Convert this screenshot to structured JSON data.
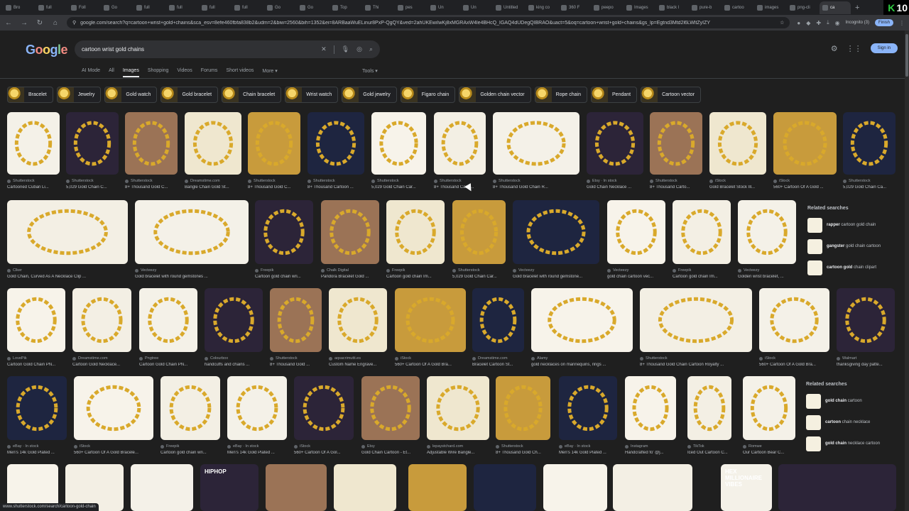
{
  "browser": {
    "tabs": [
      {
        "label": "Bro"
      },
      {
        "label": "full"
      },
      {
        "label": "Foll"
      },
      {
        "label": "Go"
      },
      {
        "label": "full"
      },
      {
        "label": "full"
      },
      {
        "label": "full"
      },
      {
        "label": "full"
      },
      {
        "label": "Go"
      },
      {
        "label": "Go"
      },
      {
        "label": "Top"
      },
      {
        "label": "Thi"
      },
      {
        "label": "pes"
      },
      {
        "label": "Un"
      },
      {
        "label": "Un"
      },
      {
        "label": "Untitled"
      },
      {
        "label": "king co"
      },
      {
        "label": "360 F"
      },
      {
        "label": "peepo"
      },
      {
        "label": "Images"
      },
      {
        "label": "black l"
      },
      {
        "label": "pure-b"
      },
      {
        "label": "cartoo"
      },
      {
        "label": "images"
      },
      {
        "label": "png-cli"
      },
      {
        "label": "ca"
      }
    ],
    "new_tab": "+",
    "profile_badge": "10",
    "profile_letter": "K",
    "url": "google.com/search?q=cartoon+wrist+gold+chains&sca_esv=8efe460fbfa838b2&udm=2&biw=2560&bih=1352&ei=8ARBaaWuELinur8PxP-QgQY&ved=2ahUKEwiIwKj8xMGRAxW4le4BHcQ_IGAQ4dUDegQIBRAO&uact=5&oq=cartoon+wrist+gold+chains&gs_lp=Egtnd3Mtd2l6LWltZyIZY",
    "incognito": "Incognito (3)",
    "finish": "Finish"
  },
  "google": {
    "logo": [
      "G",
      "o",
      "o",
      "g",
      "l",
      "e"
    ],
    "query": "cartoon wrist gold chains",
    "sign_in": "Sign in",
    "tabs": [
      "AI Mode",
      "All",
      "Images",
      "Shopping",
      "Videos",
      "Forums",
      "Short videos",
      "More ▾"
    ],
    "active_tab": "Images",
    "tools": "Tools ▾"
  },
  "chips": [
    "Bracelet",
    "Jewelry",
    "Gold watch",
    "Gold bracelet",
    "Chain bracelet",
    "Wrist watch",
    "Gold jewelry",
    "Figaro chain",
    "Golden chain vector",
    "Rope chain",
    "Pendant",
    "Cartoon vector"
  ],
  "rows": [
    [
      {
        "src": "Shutterstock",
        "title": "Cartooned Cuban Li..."
      },
      {
        "src": "Shutterstock",
        "title": "5,029 Gold Chain C..."
      },
      {
        "src": "Shutterstock",
        "title": "8+ Thousand Gold C..."
      },
      {
        "src": "Dreamstime.com",
        "title": "Bangle Chain Gold St..."
      },
      {
        "src": "Shutterstock",
        "title": "8+ Thousand Gold C..."
      },
      {
        "src": "Shutterstock",
        "title": "8+ Thousand Cartoon ..."
      },
      {
        "src": "Shutterstock",
        "title": "5,029 Gold Chain Car..."
      },
      {
        "src": "Shutterstock",
        "title": "8+ Thousand Carto..."
      },
      {
        "src": "Shutterstock",
        "title": "8+ Thousand Gold Chain R..."
      },
      {
        "src": "Etsy · In stock",
        "title": "Gold Chain Necklace ..."
      },
      {
        "src": "Shutterstock",
        "title": "8+ Thousand Carto..."
      },
      {
        "src": "iStock",
        "title": "Gold Bracelet Stock Ill..."
      },
      {
        "src": "iStock",
        "title": "560+ Cartoon Of A Gold ..."
      },
      {
        "src": "Shutterstock",
        "title": "5,029 Gold Chain Ca..."
      }
    ],
    [
      {
        "src": "Clker",
        "title": "Gold Chain, Curved As A Necklace Clip ..."
      },
      {
        "src": "Vecteezy",
        "title": "Gold bracelet with round gemstones ..."
      },
      {
        "src": "Freepik",
        "title": "Cartoon gold chain wri..."
      },
      {
        "src": "Chalk Digital",
        "title": "Pandora Bracelet Gold ..."
      },
      {
        "src": "Freepik",
        "title": "Cartoon gold chain Im..."
      },
      {
        "src": "Shutterstock",
        "title": "5,029 Gold Chain Car..."
      },
      {
        "src": "Vecteezy",
        "title": "Gold bracelet with round gemstone..."
      },
      {
        "src": "Vecteezy",
        "title": "gold chain cartoon vec..."
      },
      {
        "src": "Freepik",
        "title": "Cartoon gold chain Im..."
      },
      {
        "src": "Vecteezy",
        "title": "Golden wrist bracelet, ..."
      }
    ],
    [
      {
        "src": "LovePik",
        "title": "Cartoon Gold Chain PN..."
      },
      {
        "src": "Dreamstime.com",
        "title": "Cartoon Gold Necklace..."
      },
      {
        "src": "Pngtree",
        "title": "Cartoon Gold Chain PN..."
      },
      {
        "src": "Colourbox",
        "title": "handcuffs and chains ..."
      },
      {
        "src": "Shutterstock",
        "title": "8+ Thousand Gold ..."
      },
      {
        "src": "aqsacrimutti.es",
        "title": "Custom Name Engrave..."
      },
      {
        "src": "iStock",
        "title": "560+ Cartoon Of A Gold Bra..."
      },
      {
        "src": "Dreamstime.com",
        "title": "Bracelet Cartoon St..."
      },
      {
        "src": "Alamy",
        "title": "gold necklaces on mannequins, rings ..."
      },
      {
        "src": "Shutterstock",
        "title": "8+ Thousand Gold Chain Cartoon Royalty ..."
      },
      {
        "src": "iStock",
        "title": "560+ Cartoon Of A Gold Bra..."
      },
      {
        "src": "Walmart",
        "title": "thanksgiving day patte..."
      }
    ],
    [
      {
        "src": "eBay · In stock",
        "title": "Men's 14k Gold Plated ..."
      },
      {
        "src": "iStock",
        "title": "560+ Cartoon Of A Gold Bracele..."
      },
      {
        "src": "Freepik",
        "title": "Cartoon gold chain wri..."
      },
      {
        "src": "eBay · In stock",
        "title": "Men's 14k Gold Plated ..."
      },
      {
        "src": "iStock",
        "title": "560+ Cartoon Of A Gol..."
      },
      {
        "src": "Etsy",
        "title": "Gold Chain Cartoon - Et..."
      },
      {
        "src": "lepaystchard.com",
        "title": "Adjustable Wire Bangle..."
      },
      {
        "src": "Shutterstock",
        "title": "8+ Thousand Gold Ch..."
      },
      {
        "src": "eBay · In stock",
        "title": "Men's 14k Gold Plated ..."
      },
      {
        "src": "Instagram",
        "title": "Handcrafted fo' @j..."
      },
      {
        "src": "TikTok",
        "title": "Iced Out Cartoon C..."
      },
      {
        "src": "Romwe",
        "title": "Our Cartoon Bear C..."
      }
    ]
  ],
  "related_1": {
    "heading": "Related searches",
    "items": [
      {
        "bold": "rapper",
        "rest": " cartoon gold chain"
      },
      {
        "bold": "gangster",
        "rest": " gold chain cartoon"
      },
      {
        "bold": "cartoon gold ",
        "rest": "chain clipart"
      }
    ]
  },
  "related_2": {
    "heading": "Related searches",
    "items": [
      {
        "bold": "gold chain",
        "rest": " cartoon"
      },
      {
        "bold": "cartoon ",
        "rest": "chain necklace"
      },
      {
        "bold": "gold chain ",
        "rest": "necklace cartoon"
      }
    ]
  },
  "row5_labels": [
    "HIPHOP",
    "HEX MILLIONAIRE VIBES"
  ],
  "statusbar": "www.shutterstock.com/search/cartoon-gold-chain",
  "colors": {
    "bg": "#1f1f1f",
    "accent": "#8ab4f8",
    "gold": "#d9a92b"
  }
}
